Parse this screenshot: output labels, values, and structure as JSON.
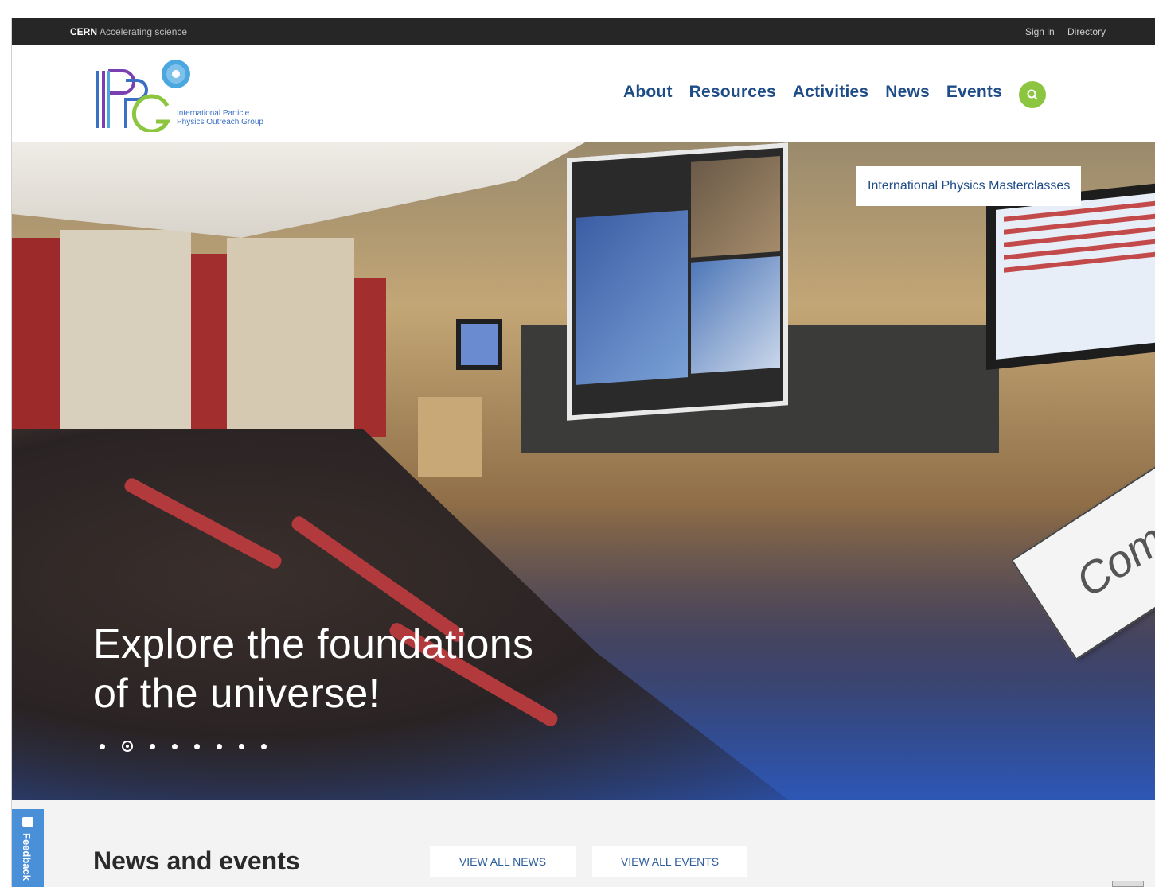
{
  "cern_bar": {
    "brand": "CERN",
    "tagline": "Accelerating science",
    "links": [
      "Sign in",
      "Directory"
    ]
  },
  "logo": {
    "line1": "International Particle",
    "line2": "Physics Outreach Group",
    "colors": {
      "blue": "#3a6fc4",
      "purple": "#7a3fb0",
      "green": "#8cc640",
      "light_blue": "#4aa7df"
    }
  },
  "nav": {
    "items": [
      "About",
      "Resources",
      "Activities",
      "News",
      "Events"
    ],
    "search_icon": "search-icon",
    "color": "#1e4c87",
    "search_color": "#8cc640"
  },
  "hero": {
    "tag": "International Physics Masterclasses",
    "title_line1": "Explore the foundations",
    "title_line2": "of the universe!",
    "dots_count": 8,
    "active_dot": 2,
    "sticker_text": "Comin"
  },
  "news": {
    "title": "News and events",
    "view_all_news": "VIEW ALL NEWS",
    "view_all_events": "VIEW ALL EVENTS"
  },
  "feedback": {
    "label": "Feedback"
  }
}
